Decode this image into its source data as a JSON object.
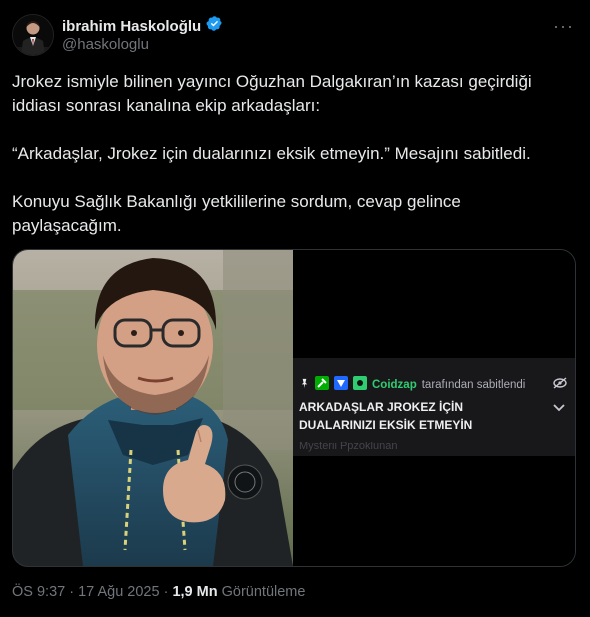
{
  "author": {
    "name": "ibrahim Haskoloğlu",
    "handle": "@haskologlu",
    "verified": true,
    "verified_color": "#1d9bf0",
    "avatar_icon": "profile-avatar"
  },
  "menu_icon": "more-horizontal-icon",
  "tweet": {
    "paragraphs": [
      "Jrokez ismiyle bilinen yayıncı Oğuzhan Dalgakıran’ın kazası geçirdiği iddiası sonrası kanalına ekip arkadaşları:",
      "“Arkadaşlar, Jrokez için dualarınızı eksik etmeyin.” Mesajını sabitledi.",
      "Konuyu Sağlık Bakanlığı yetkililerine sordum, cevap gelince paylaşacağım."
    ]
  },
  "media": {
    "photo_icon": "person-photo",
    "pinned": {
      "username": "Coidzap",
      "by_text": "tarafından sabitlendi",
      "message_line1": "ARKADAŞLAR JROKEZ İÇİN",
      "message_line2": "DUALARINIZI EKSİK ETMEYİN",
      "below_text": "Mysterii Ppzoklunan",
      "user_color": "#2fcc71",
      "panel_color": "#18181b"
    }
  },
  "footer": {
    "time": "ÖS 9:37",
    "separator": "·",
    "date": "17 Ağu 2025",
    "views_count": "1,9 Mn",
    "views_label": "Görüntüleme"
  }
}
